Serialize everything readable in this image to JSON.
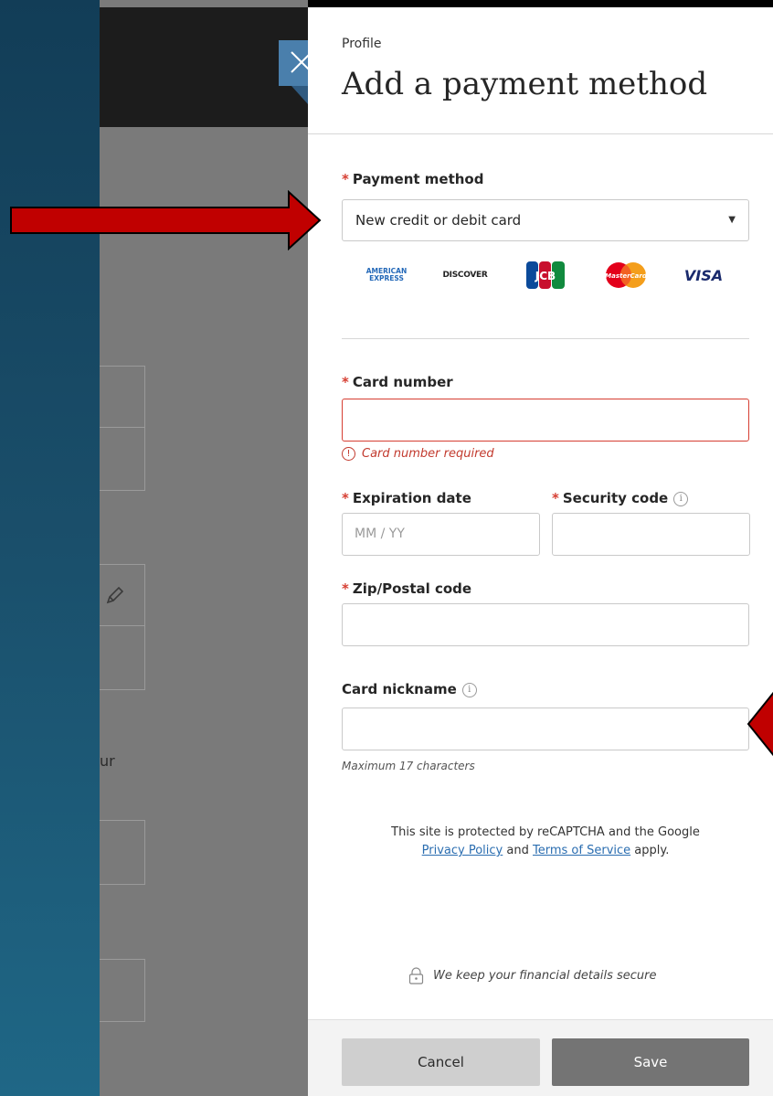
{
  "panel": {
    "breadcrumb": "Profile",
    "title": "Add a payment method"
  },
  "payment_method": {
    "label": "Payment method",
    "selected": "New credit or debit card",
    "card_brands": [
      "AMERICAN EXPRESS",
      "DISCOVER",
      "JCB",
      "MasterCard",
      "VISA"
    ]
  },
  "card_number": {
    "label": "Card number",
    "value": "",
    "error": "Card number required"
  },
  "expiration": {
    "label": "Expiration date",
    "placeholder": "MM / YY"
  },
  "security_code": {
    "label": "Security code",
    "value": ""
  },
  "zip": {
    "label": "Zip/Postal code",
    "value": ""
  },
  "nickname": {
    "label": "Card nickname",
    "value": "",
    "helper": "Maximum 17 characters"
  },
  "recaptcha": {
    "line1": "This site is protected by reCAPTCHA and the Google",
    "privacy": "Privacy Policy",
    "and": "and",
    "terms": "Terms of Service",
    "apply": "apply."
  },
  "secure_note": "We keep your financial details secure",
  "actions": {
    "cancel": "Cancel",
    "save": "Save"
  },
  "background": {
    "partial_text": "ur"
  },
  "colors": {
    "required_asterisk": "#d63e32",
    "error": "#d63e32",
    "link": "#2a6db0",
    "close_tab": "#4a7fac",
    "annotation_arrow": "#c00000"
  }
}
